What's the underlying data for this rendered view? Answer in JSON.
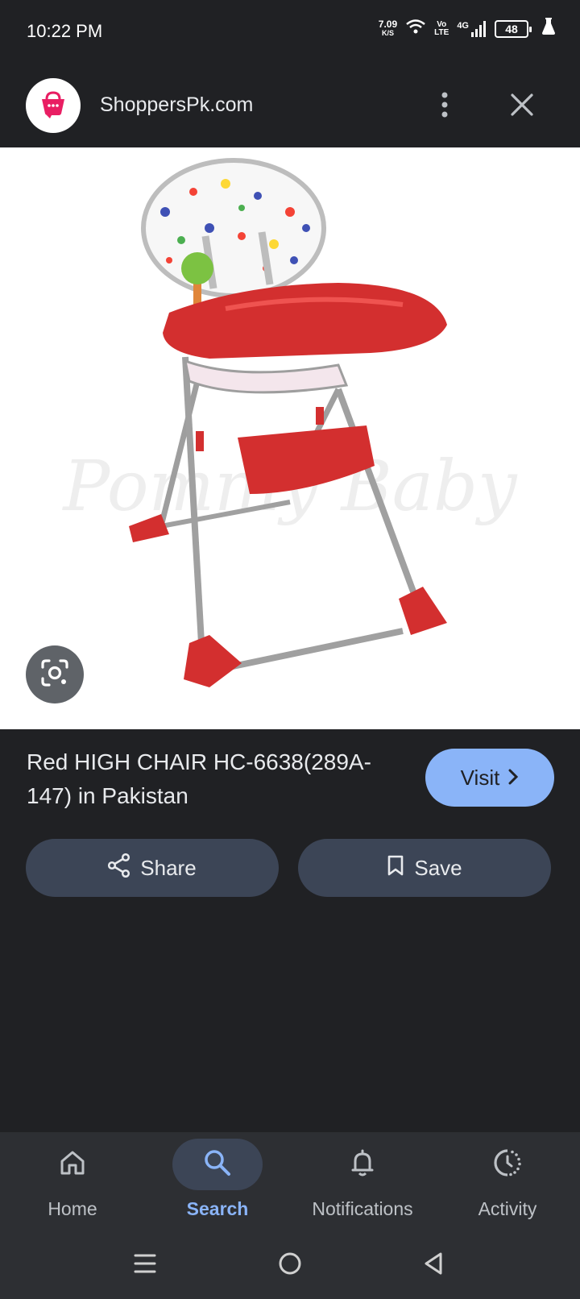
{
  "status": {
    "time": "10:22 PM",
    "net_speed_value": "7.09",
    "net_speed_unit": "K/S",
    "volte_top": "Vo",
    "volte_bottom": "LTE",
    "network": "4G",
    "battery": "48"
  },
  "header": {
    "site_name": "ShoppersPk.com",
    "logo_icon": "shopping-bag-icon",
    "logo_color": "#e91e63"
  },
  "image": {
    "watermark": "Pommy Baby"
  },
  "result": {
    "title": "Red HIGH CHAIR HC-6638(289A-147) in Pakistan",
    "visit_label": "Visit"
  },
  "actions": {
    "share_label": "Share",
    "save_label": "Save"
  },
  "bottom_nav": {
    "items": [
      {
        "label": "Home",
        "icon": "home-icon"
      },
      {
        "label": "Search",
        "icon": "search-icon"
      },
      {
        "label": "Notifications",
        "icon": "bell-icon"
      },
      {
        "label": "Activity",
        "icon": "activity-icon"
      }
    ],
    "active": "Search"
  },
  "colors": {
    "background": "#202124",
    "accent": "#8ab4f8",
    "chair_red": "#d32f2f"
  }
}
